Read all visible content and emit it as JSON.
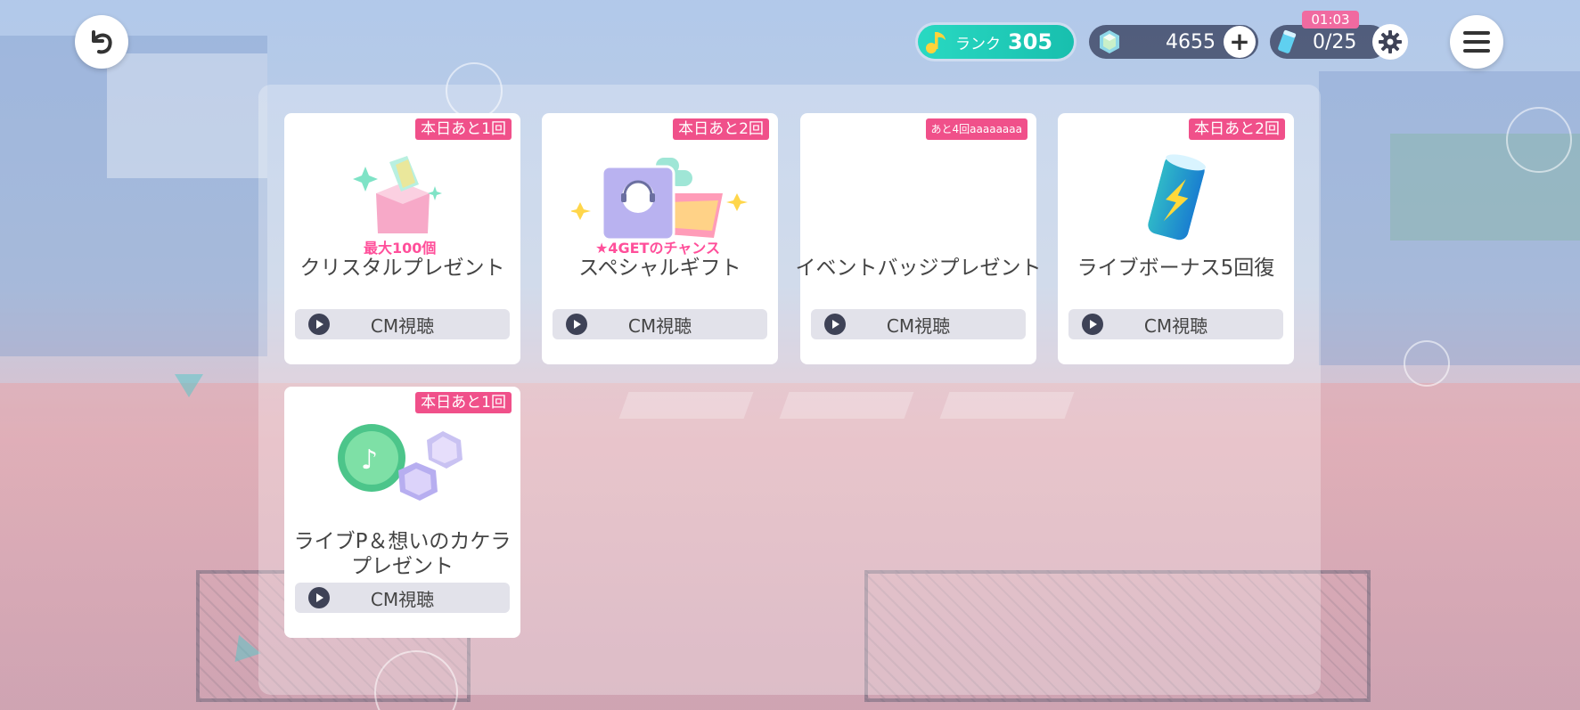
{
  "header": {
    "rank_label": "ランク",
    "rank_value": "305",
    "crystal_count": "4655",
    "stamina": "0/25",
    "stamina_timer": "01:03"
  },
  "icons": {
    "back": "back-arrow-icon",
    "menu": "hamburger-menu-icon",
    "settings": "gear-icon",
    "rank": "music-note-icon",
    "crystal": "crystal-icon",
    "stamina": "energy-drink-icon",
    "plus": "plus-icon"
  },
  "cards": [
    {
      "badge": "本日あと1回",
      "title": "クリスタルプレゼント",
      "button": "CM視聴",
      "image_caption": "最大100個"
    },
    {
      "badge": "本日あと2回",
      "title": "スペシャルギフト",
      "button": "CM視聴",
      "image_caption": "★4GETのチャンス"
    },
    {
      "badge": "あと4回aaaaaaaa",
      "title": "イベントバッジプレゼント",
      "button": "CM視聴"
    },
    {
      "badge": "本日あと2回",
      "title": "ライブボーナス5回復",
      "button": "CM視聴"
    },
    {
      "badge": "本日あと1回",
      "title_line1": "ライブP＆想いのカケラ",
      "title_line2": "プレゼント",
      "button": "CM視聴"
    }
  ],
  "colors": {
    "accent_pink": "#f0508a",
    "rank_teal": "#1fcbb6",
    "button_gray": "#e2e2ea"
  }
}
